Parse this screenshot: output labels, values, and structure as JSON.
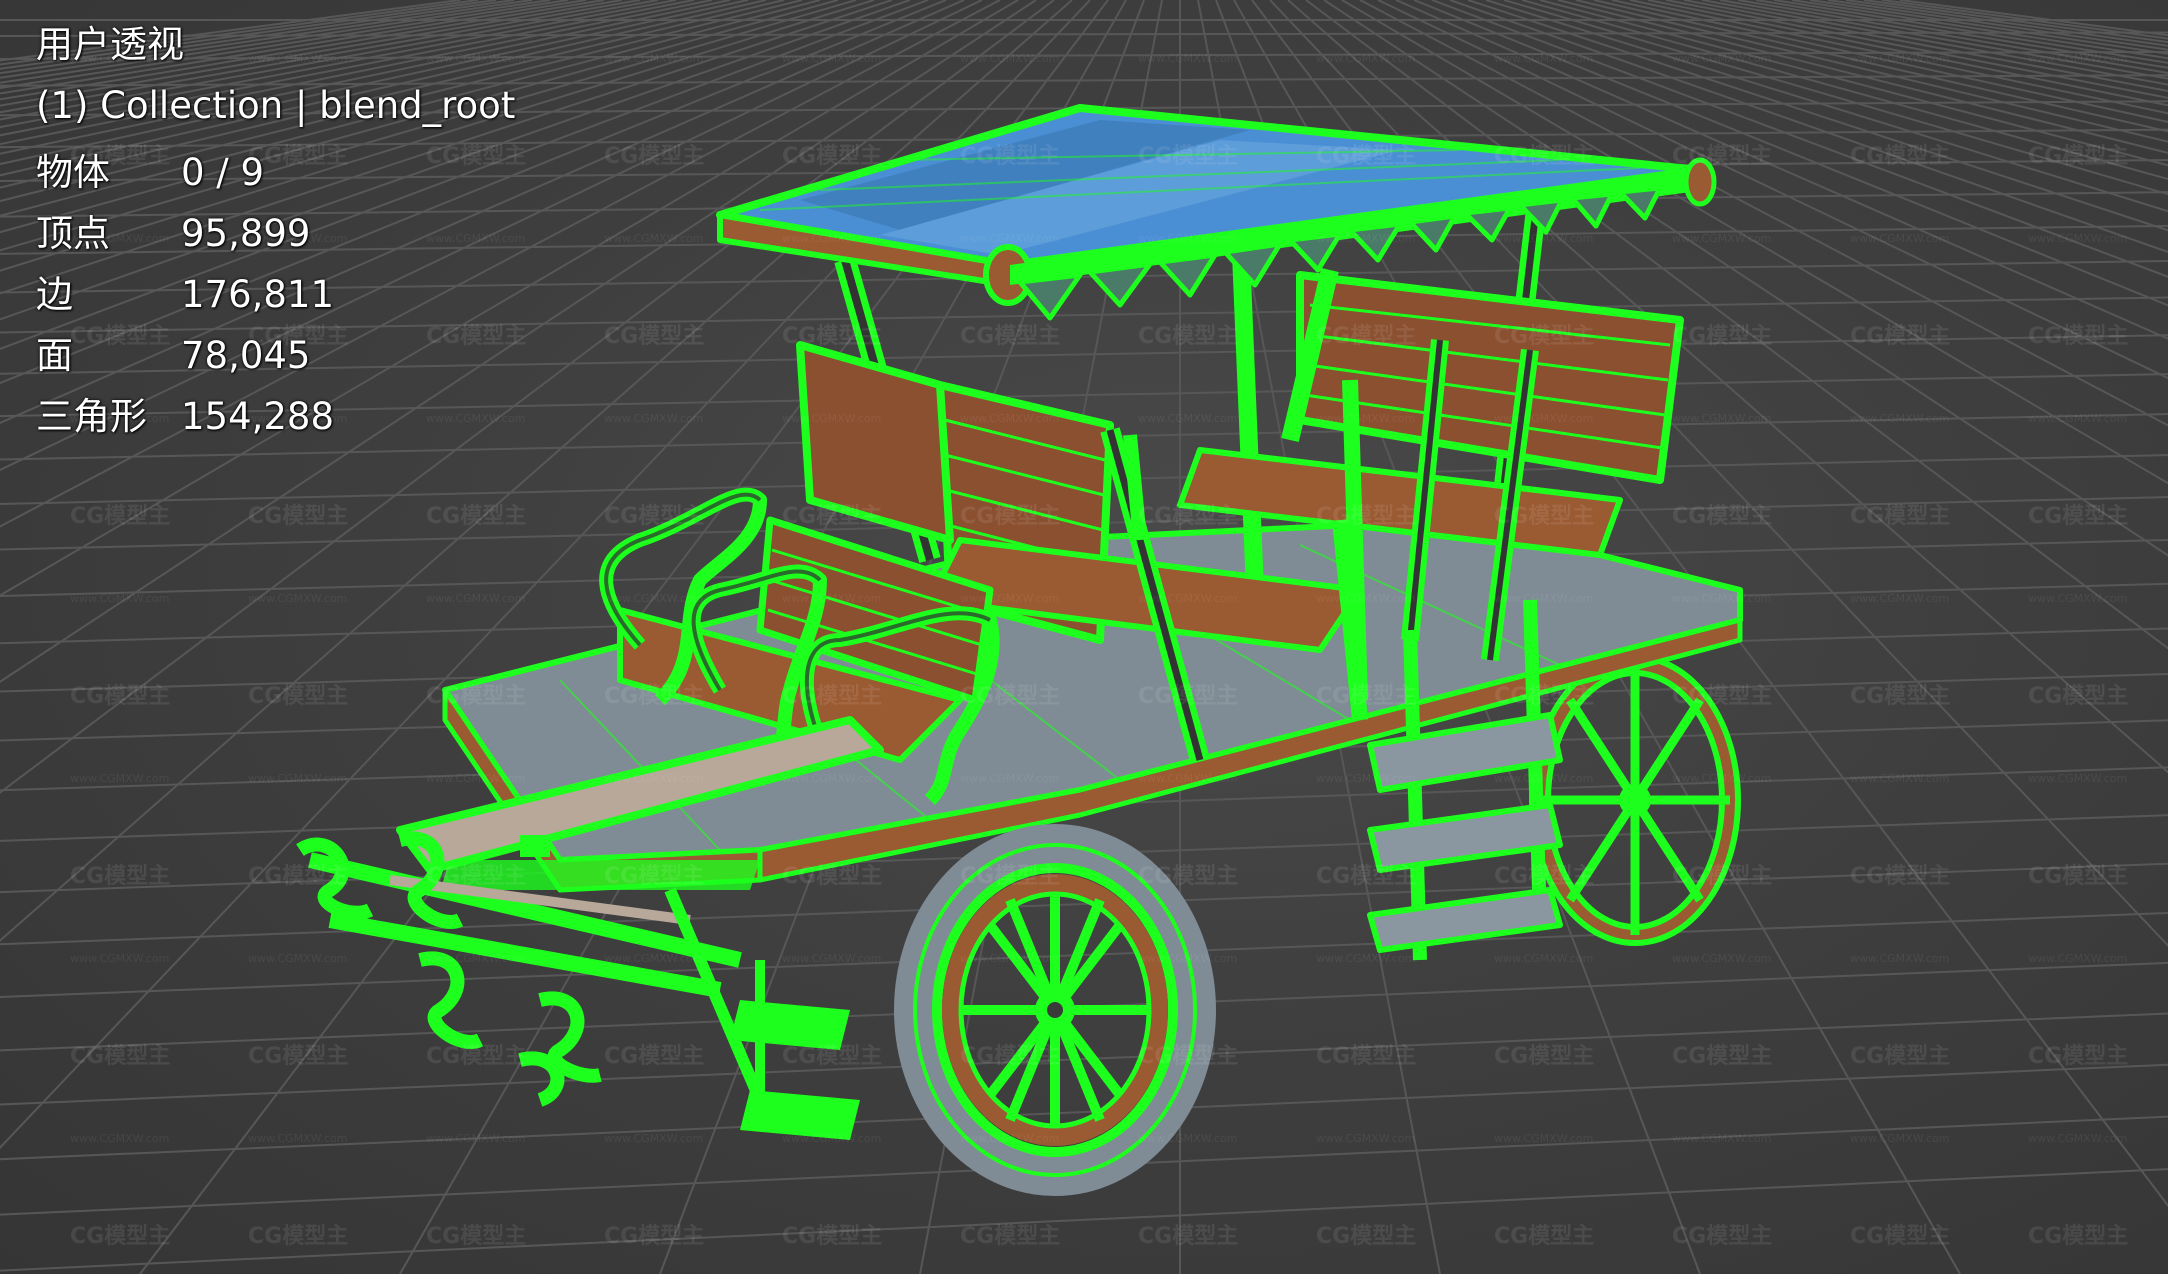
{
  "viewport": {
    "view_name": "用户透视",
    "collection_label": "(1) Collection | blend_root",
    "stats": [
      {
        "label": "物体",
        "value": "0 / 9"
      },
      {
        "label": "顶点",
        "value": "95,899"
      },
      {
        "label": "边",
        "value": "176,811"
      },
      {
        "label": "面",
        "value": "78,045"
      },
      {
        "label": "三角形",
        "value": "154,288"
      }
    ],
    "watermark": "CG模型主",
    "watermark_url": "www.CGMXW.com",
    "colors": {
      "background": "#3d3d3d",
      "grid": "#555555",
      "wire_select": "#1dff1d",
      "wood": "#9a5a32",
      "canopy": "#4a8fd4",
      "floor": "#8a96a0"
    }
  }
}
